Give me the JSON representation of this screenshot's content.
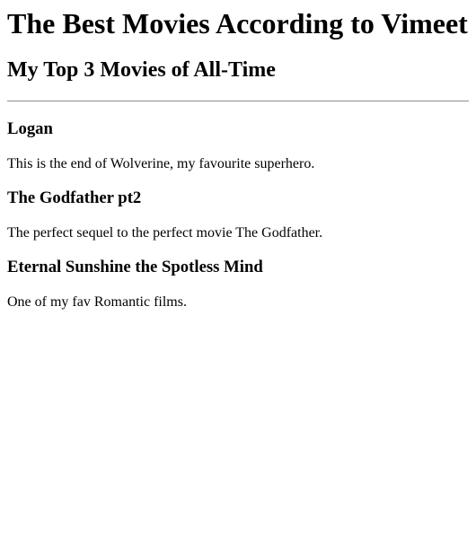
{
  "header": {
    "title": "The Best Movies According to Vimeet",
    "subtitle": "My Top 3 Movies of All-Time"
  },
  "movies": [
    {
      "name": "Logan",
      "description": "This is the end of Wolverine, my favourite superhero."
    },
    {
      "name": "The Godfather pt2",
      "description": "The perfect sequel to the perfect movie The Godfather."
    },
    {
      "name": "Eternal Sunshine the Spotless Mind",
      "description": "One of my fav Romantic films."
    }
  ]
}
